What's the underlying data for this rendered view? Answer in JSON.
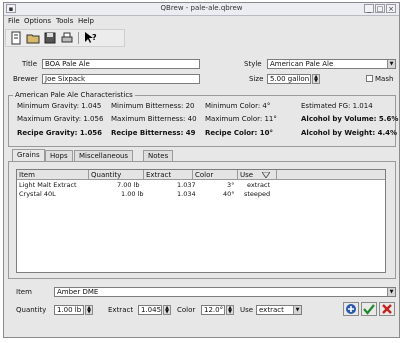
{
  "window": {
    "title": "QBrew - pale-ale.qbrew"
  },
  "menu": [
    "File",
    "Options",
    "Tools",
    "Help"
  ],
  "recipe": {
    "title_label": "Title",
    "title_value": "BOA Pale Ale",
    "style_label": "Style",
    "style_value": "American Pale Ale",
    "brewer_label": "Brewer",
    "brewer_value": "Joe Sixpack",
    "size_label": "Size",
    "size_value": "5.00 gallon",
    "mash_label": "Mash"
  },
  "characteristics": {
    "title": "American Pale Ale Characteristics",
    "min_gravity": "Minimum Gravity: 1.045",
    "min_bitterness": "Minimum Bitterness: 20",
    "min_color": "Minimum Color: 4°",
    "estimated": "Estimated FG: 1.014",
    "max_gravity": "Maximum Gravity: 1.056",
    "max_bitterness": "Maximum Bitterness: 40",
    "max_color": "Maximum Color: 11°",
    "abv_vol": "Alcohol by Volume: 5.6%",
    "recipe_gravity": "Recipe Gravity: 1.056",
    "recipe_bitterness": "Recipe Bitterness: 49",
    "recipe_color": "Recipe Color: 10°",
    "abv_wt": "Alcohol by Weight: 4.4%"
  },
  "tabs": [
    "Grains",
    "Hops",
    "Miscellaneous",
    "Notes"
  ],
  "grains": {
    "columns": [
      "Item",
      "Quantity",
      "Extract",
      "Color",
      "Use"
    ],
    "rows": [
      {
        "item": "Light Malt Extract",
        "quantity": "7.00 lb",
        "extract": "1.037",
        "color": "3°",
        "use": "extract"
      },
      {
        "item": "Crystal 40L",
        "quantity": "1.00 lb",
        "extract": "1.034",
        "color": "40°",
        "use": "steeped"
      }
    ]
  },
  "editor": {
    "item_label": "Item",
    "item_value": "Amber DME",
    "quantity_label": "Quantity",
    "quantity_value": "1.00 lb",
    "extract_label": "Extract",
    "extract_value": "1.045",
    "color_label": "Color",
    "color_value": "12.0°",
    "use_label": "Use",
    "use_value": "extract"
  }
}
